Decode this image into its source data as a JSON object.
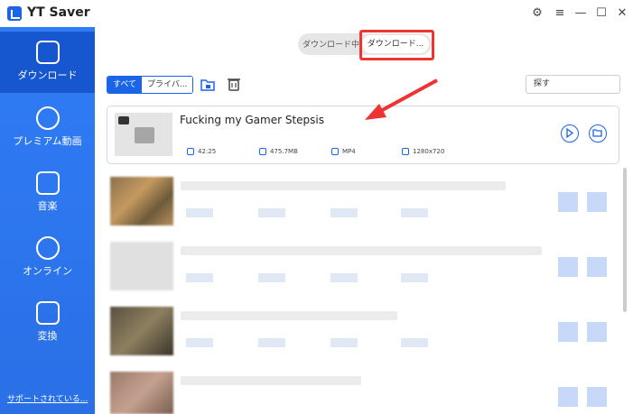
{
  "app": {
    "title": "YT Saver"
  },
  "window_controls": [
    "⚙",
    "≡",
    "—",
    "☐",
    "✕"
  ],
  "sidebar": {
    "items": [
      {
        "label": "ダウンロード",
        "icon": "download-icon",
        "active": true
      },
      {
        "label": "プレミアム動画",
        "icon": "play-icon",
        "active": false
      },
      {
        "label": "音楽",
        "icon": "music-icon",
        "active": false
      },
      {
        "label": "オンライン",
        "icon": "globe-icon",
        "active": false
      },
      {
        "label": "変換",
        "icon": "convert-icon",
        "active": false
      }
    ],
    "support_link": "サポートされている..."
  },
  "status_toggle": {
    "downloading": "ダウンロード中",
    "downloaded": "ダウンロード..."
  },
  "filter_tabs": {
    "all": "すべて",
    "private": "プライバ..."
  },
  "search": {
    "placeholder": "探す"
  },
  "first_item": {
    "title": "Fucking my Gamer Stepsis",
    "duration": "42:25",
    "size": "475.7MB",
    "format": "MP4",
    "resolution": "1280x720"
  },
  "colors": {
    "accent": "#1a64e8",
    "highlight": "#e33333",
    "sidebar": "#2f7df6"
  }
}
